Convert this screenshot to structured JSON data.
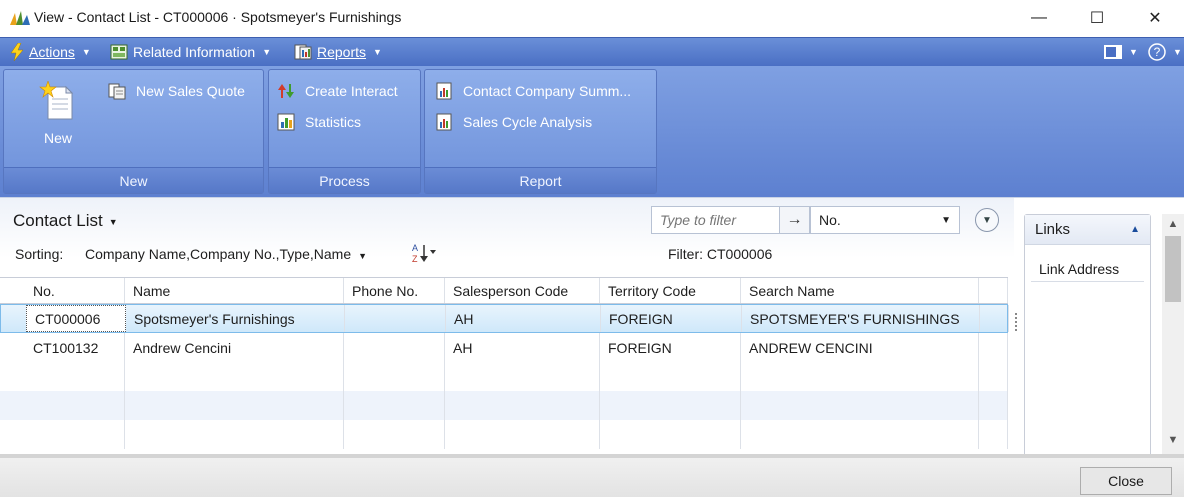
{
  "window": {
    "title": "View - Contact List - CT000006 · Spotsmeyer's Furnishings",
    "minimize": "—",
    "maximize": "☐",
    "close": "✕"
  },
  "commandbar": {
    "actions": "Actions",
    "related": "Related Information",
    "reports": "Reports"
  },
  "ribbon": {
    "new_group": {
      "title": "New",
      "new_label": "New",
      "new_sales_quote": "New Sales Quote"
    },
    "process_group": {
      "title": "Process",
      "create_interact": "Create Interact",
      "statistics": "Statistics"
    },
    "report_group": {
      "title": "Report",
      "contact_company_summary": "Contact Company Summ...",
      "sales_cycle_analysis": "Sales Cycle Analysis"
    }
  },
  "list": {
    "title": "Contact List",
    "sorting_label": "Sorting:",
    "sorting_value": "Company Name,Company No.,Type,Name",
    "filter_placeholder": "Type to filter",
    "filter_field": "No.",
    "filter_text": "Filter: CT000006",
    "columns": [
      "No.",
      "Name",
      "Phone No.",
      "Salesperson Code",
      "Territory Code",
      "Search Name"
    ],
    "rows": [
      {
        "no": "CT000006",
        "name": "Spotsmeyer's Furnishings",
        "phone": "",
        "salesperson": "AH",
        "territory": "FOREIGN",
        "search": "SPOTSMEYER'S FURNISHINGS"
      },
      {
        "no": "CT100132",
        "name": "Andrew Cencini",
        "phone": "",
        "salesperson": "AH",
        "territory": "FOREIGN",
        "search": "ANDREW CENCINI"
      }
    ]
  },
  "links": {
    "title": "Links",
    "column": "Link Address"
  },
  "footer": {
    "close": "Close"
  },
  "colors": {
    "ribbon_blue": "#6c8fd9",
    "selection": "#cfe8fa"
  }
}
